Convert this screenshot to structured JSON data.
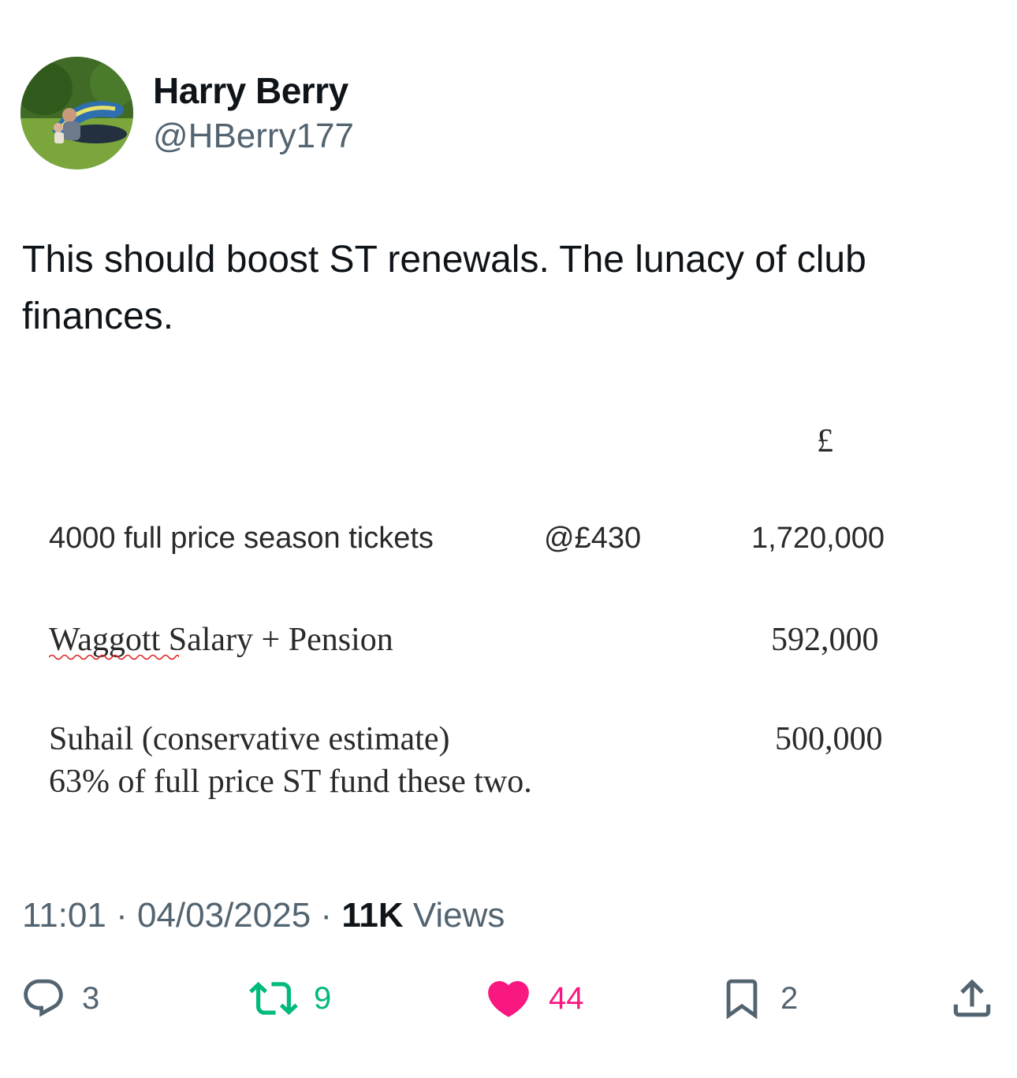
{
  "author": {
    "name": "Harry Berry",
    "handle": "@HBerry177"
  },
  "tweet": {
    "text": "This should boost ST renewals. The lunacy of club finances."
  },
  "attached_image": {
    "currency_header": "£",
    "rows": [
      {
        "label": "4000 full price season tickets",
        "rate": "@£430",
        "value": "1,720,000"
      },
      {
        "label": "Waggott Salary + Pension",
        "value": "592,000"
      },
      {
        "label": "Suhail (conservative estimate)",
        "value": "500,000",
        "note": "63% of full price ST fund these two."
      }
    ]
  },
  "meta": {
    "time": "11:01",
    "separator": "·",
    "date": "04/03/2025",
    "views_count": "11K",
    "views_label": "Views"
  },
  "actions": {
    "replies": "3",
    "retweets": "9",
    "likes": "44",
    "bookmarks": "2"
  },
  "icons": {
    "reply": "reply-icon",
    "retweet": "retweet-icon",
    "like": "heart-icon",
    "bookmark": "bookmark-icon",
    "share": "share-icon"
  },
  "colors": {
    "text": "#0f1419",
    "secondary": "#536471",
    "retweet": "#00ba7c",
    "like": "#f91880"
  }
}
